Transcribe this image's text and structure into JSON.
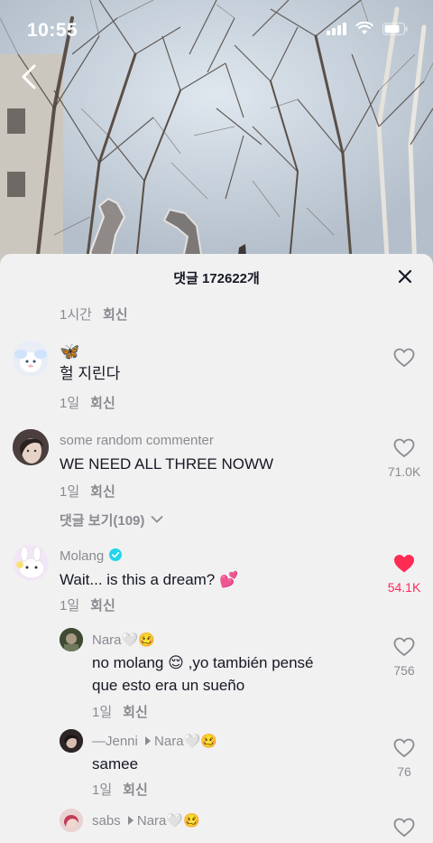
{
  "status": {
    "time": "10:55"
  },
  "sheet": {
    "title": "댓글 172622개"
  },
  "top_meta": {
    "age": "1시간",
    "reply": "회신"
  },
  "comments": [
    {
      "username": "🦋",
      "text": "헐 지린다",
      "age": "1일",
      "reply": "회신",
      "likes": ""
    },
    {
      "username": "some random commenter",
      "text": "WE NEED ALL THREE NOWW",
      "age": "1일",
      "reply": "회신",
      "likes": "71.0K",
      "view_replies": "댓글 보기(109)"
    },
    {
      "username": "Molang",
      "verified": true,
      "text": "Wait... is this a dream?",
      "text_emoji": "💕",
      "age": "1일",
      "reply": "회신",
      "likes": "54.1K",
      "liked": true
    }
  ],
  "replies": [
    {
      "username": "Nara",
      "username_emoji": "🤍🥴",
      "text_line1_a": "no molang",
      "text_line1_emoji": "😌",
      "text_line1_b": ",yo también pensé",
      "text_line2": "que esto era un sueño",
      "age": "1일",
      "reply": "회신",
      "likes": "756"
    },
    {
      "username": "—Jenni",
      "reply_to": "Nara",
      "reply_to_emoji": "🤍🥴",
      "text": "samee",
      "age": "1일",
      "reply": "회신",
      "likes": "76"
    },
    {
      "username": "sabs",
      "reply_to": "Nara",
      "reply_to_emoji": "🤍🥴",
      "text": "",
      "age": "",
      "reply": "",
      "likes": ""
    }
  ],
  "colors": {
    "accent_like": "#fe2c55",
    "verified": "#20d5ec",
    "sheet_bg": "#f1f1f2"
  }
}
